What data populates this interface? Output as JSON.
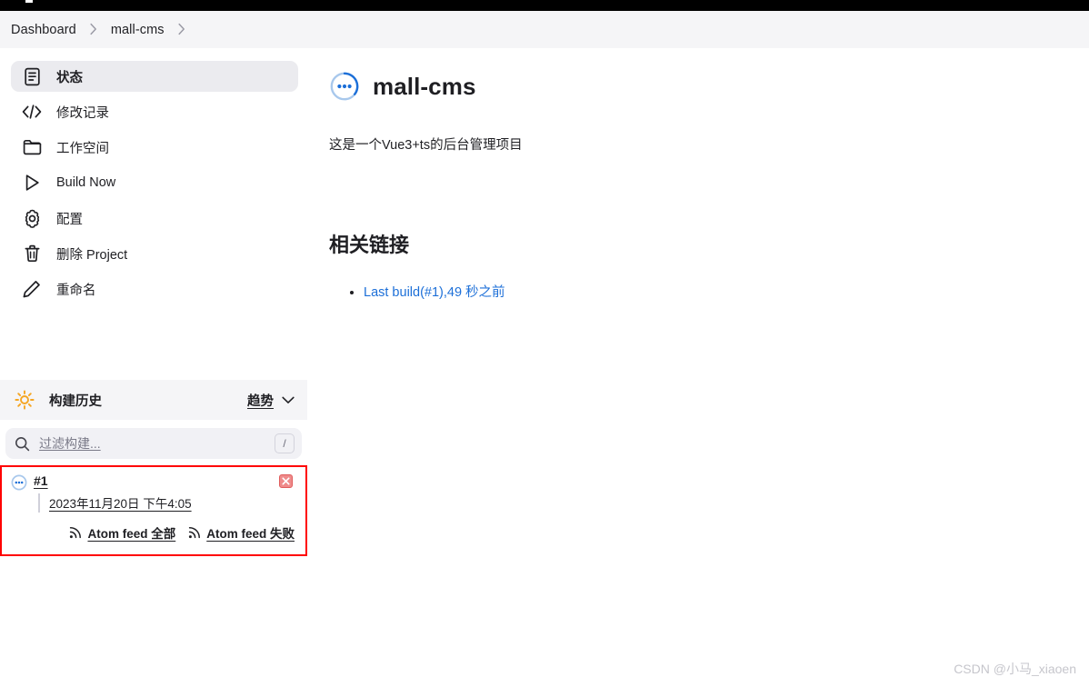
{
  "breadcrumb": {
    "items": [
      {
        "label": "Dashboard"
      },
      {
        "label": "mall-cms"
      }
    ]
  },
  "sidebar": {
    "tasks": [
      {
        "label": "状态",
        "icon": "document-icon",
        "active": true
      },
      {
        "label": "修改记录",
        "icon": "code-icon",
        "active": false
      },
      {
        "label": "工作空间",
        "icon": "folder-icon",
        "active": false
      },
      {
        "label": "Build Now",
        "icon": "play-icon",
        "active": false
      },
      {
        "label": "配置",
        "icon": "gear-icon",
        "active": false
      },
      {
        "label": "删除 Project",
        "icon": "trash-icon",
        "active": false
      },
      {
        "label": "重命名",
        "icon": "pencil-icon",
        "active": false
      }
    ]
  },
  "build_history": {
    "title": "构建历史",
    "sun_icon": "sun-icon",
    "trend_label": "趋势",
    "chevron_icon": "chevron-down-icon",
    "search": {
      "placeholder": "过滤构建...",
      "value": "",
      "shortcut": "/",
      "icon": "search-icon"
    },
    "builds": [
      {
        "number": "#1",
        "timestamp": "2023年11月20日 下午4:05",
        "status_icon": "in-progress-icon",
        "delete_label": "×",
        "in_progress": true
      }
    ],
    "feeds": [
      {
        "label": "Atom feed 全部",
        "icon": "rss-icon"
      },
      {
        "label": "Atom feed 失败",
        "icon": "rss-icon"
      }
    ]
  },
  "main": {
    "job_title": "mall-cms",
    "job_status_icon": "in-progress-icon",
    "description": "这是一个Vue3+ts的后台管理项目",
    "section_title": "相关链接",
    "links": [
      {
        "label": "Last build(#1),49 秒之前"
      }
    ]
  },
  "watermark": {
    "text": "CSDN @小马_xiaoen"
  },
  "colors": {
    "accent_blue": "#1c6fd8",
    "progress_blue": "#2f5fa3",
    "highlight_red": "#ff0000",
    "sun_yellow": "#f5a623",
    "panel_grey": "#f5f5f7",
    "delete_red": "#e05c5c"
  }
}
